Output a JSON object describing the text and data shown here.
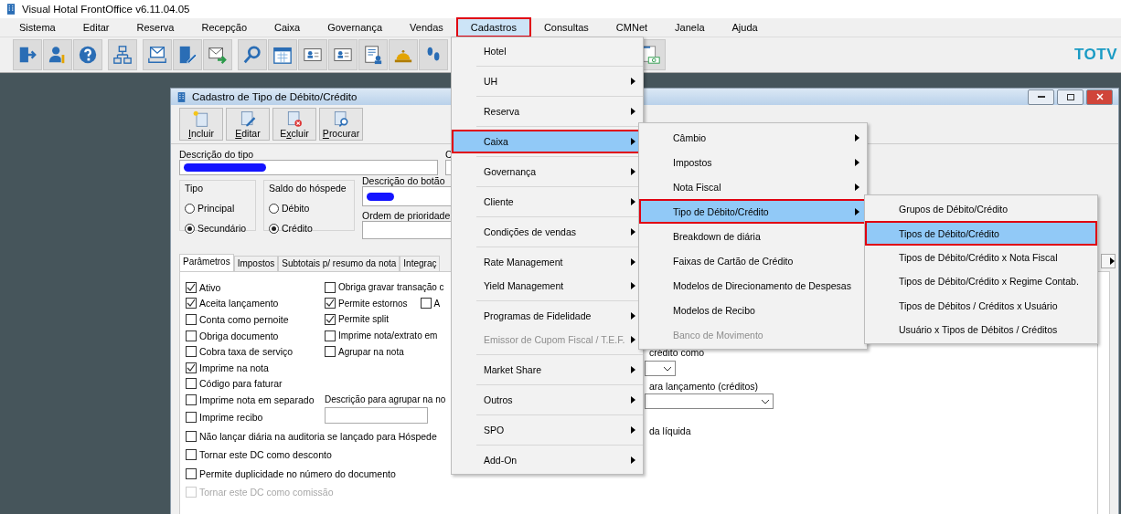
{
  "app": {
    "title": "Visual Hotal FrontOffice v6.11.04.05",
    "brand": "TOTV"
  },
  "menubar": [
    {
      "label": "Sistema",
      "selected": false,
      "highlighted": false
    },
    {
      "label": "Editar",
      "selected": false,
      "highlighted": false
    },
    {
      "label": "Reserva",
      "selected": false,
      "highlighted": false
    },
    {
      "label": "Recepção",
      "selected": false,
      "highlighted": false
    },
    {
      "label": "Caixa",
      "selected": false,
      "highlighted": false
    },
    {
      "label": "Governança",
      "selected": false,
      "highlighted": false
    },
    {
      "label": "Vendas",
      "selected": false,
      "highlighted": false
    },
    {
      "label": "Cadastros",
      "selected": true,
      "highlighted": true
    },
    {
      "label": "Consultas",
      "selected": false,
      "highlighted": false
    },
    {
      "label": "CMNet",
      "selected": false,
      "highlighted": false
    },
    {
      "label": "Janela",
      "selected": false,
      "highlighted": false
    },
    {
      "label": "Ajuda",
      "selected": false,
      "highlighted": false
    }
  ],
  "dialog": {
    "title": "Cadastro de Tipo de Débito/Crédito",
    "toolbar": [
      {
        "label": "Incluir"
      },
      {
        "label": "Editar"
      },
      {
        "label": "Excluir"
      },
      {
        "label": "Procurar"
      }
    ],
    "description": {
      "label": "Descrição do tipo",
      "redacted": true
    },
    "code": {
      "label": "C"
    },
    "tipo": {
      "title": "Tipo",
      "options": [
        {
          "label": "Principal",
          "selected": false
        },
        {
          "label": "Secundário",
          "selected": true
        }
      ]
    },
    "saldo": {
      "title": "Saldo do hóspede",
      "options": [
        {
          "label": "Débito",
          "selected": false
        },
        {
          "label": "Crédito",
          "selected": true
        }
      ]
    },
    "button_description": {
      "label": "Descrição do botão",
      "redacted": true
    },
    "priority": {
      "label": "Ordem de prioridade"
    },
    "tabs": [
      {
        "label": "Parâmetros",
        "selected": true
      },
      {
        "label": "Impostos",
        "selected": false
      },
      {
        "label": "Subtotais p/ resumo da nota",
        "selected": false
      },
      {
        "label": "Integraç",
        "selected": false
      }
    ],
    "checks_left": [
      {
        "label": "Ativo",
        "checked": true,
        "disabled": false
      },
      {
        "label": "Aceita lançamento",
        "checked": true,
        "disabled": false
      },
      {
        "label": "Conta como pernoite",
        "checked": false,
        "disabled": false
      },
      {
        "label": "Obriga documento",
        "checked": false,
        "disabled": false
      },
      {
        "label": "Cobra taxa de serviço",
        "checked": false,
        "disabled": false
      },
      {
        "label": "Imprime na nota",
        "checked": true,
        "disabled": false
      },
      {
        "label": "Código para faturar",
        "checked": false,
        "disabled": false
      },
      {
        "label": "Imprime nota em separado",
        "checked": false,
        "disabled": false
      },
      {
        "label": "Imprime recibo",
        "checked": false,
        "disabled": false
      },
      {
        "label": "Não lançar diária na auditoria se lançado para Hóspede",
        "checked": false,
        "disabled": false
      },
      {
        "label": "Tornar este DC como desconto",
        "checked": false,
        "disabled": false
      },
      {
        "label": "Permite duplicidade no número do documento",
        "checked": false,
        "disabled": false
      },
      {
        "label": "Tornar este DC como comissão",
        "checked": false,
        "disabled": true
      }
    ],
    "checks_right": [
      {
        "label": "Obriga gravar transação c",
        "checked": false
      },
      {
        "label": "Permite estornos",
        "checked": true,
        "beside": {
          "label": "A",
          "checked": false
        }
      },
      {
        "label": "Permite split",
        "checked": true
      },
      {
        "label": "Imprime nota/extrato em",
        "checked": false
      },
      {
        "label": "Agrupar na nota",
        "checked": false
      }
    ],
    "group_description": {
      "label": "Descrição para agrupar na no"
    },
    "credit_as": {
      "label": "crédito como"
    },
    "posting": {
      "label": "ara lançamento (créditos)"
    },
    "net": {
      "label": "da líquida"
    }
  },
  "menus": [
    {
      "groups": [
        [
          {
            "label": "Hotel",
            "submenu": false,
            "selected": false,
            "highlighted": false,
            "disabled": false
          }
        ],
        [
          {
            "label": "UH",
            "submenu": true,
            "selected": false,
            "highlighted": false,
            "disabled": false
          }
        ],
        [
          {
            "label": "Reserva",
            "submenu": true,
            "selected": false,
            "highlighted": false,
            "disabled": false
          }
        ],
        [
          {
            "label": "Caixa",
            "submenu": true,
            "selected": true,
            "highlighted": true,
            "disabled": false
          }
        ],
        [
          {
            "label": "Governança",
            "submenu": true,
            "selected": false,
            "highlighted": false,
            "disabled": false
          }
        ],
        [
          {
            "label": "Cliente",
            "submenu": true,
            "selected": false,
            "highlighted": false,
            "disabled": false
          }
        ],
        [
          {
            "label": "Condições de vendas",
            "submenu": true,
            "selected": false,
            "highlighted": false,
            "disabled": false
          }
        ],
        [
          {
            "label": "Rate Management",
            "submenu": true,
            "selected": false,
            "highlighted": false,
            "disabled": false
          },
          {
            "label": "Yield Management",
            "submenu": true,
            "selected": false,
            "highlighted": false,
            "disabled": false
          }
        ],
        [
          {
            "label": "Programas de Fidelidade",
            "submenu": true,
            "selected": false,
            "highlighted": false,
            "disabled": false
          },
          {
            "label": "Emissor de Cupom Fiscal / T.E.F.",
            "submenu": true,
            "selected": false,
            "highlighted": false,
            "disabled": true
          }
        ],
        [
          {
            "label": "Market Share",
            "submenu": true,
            "selected": false,
            "highlighted": false,
            "disabled": false
          }
        ],
        [
          {
            "label": "Outros",
            "submenu": true,
            "selected": false,
            "highlighted": false,
            "disabled": false
          }
        ],
        [
          {
            "label": "SPO",
            "submenu": true,
            "selected": false,
            "highlighted": false,
            "disabled": false
          }
        ],
        [
          {
            "label": "Add-On",
            "submenu": true,
            "selected": false,
            "highlighted": false,
            "disabled": false
          }
        ]
      ]
    },
    {
      "groups": [
        [
          {
            "label": "Câmbio",
            "submenu": true,
            "selected": false,
            "highlighted": false,
            "disabled": false
          },
          {
            "label": "Impostos",
            "submenu": true,
            "selected": false,
            "highlighted": false,
            "disabled": false
          },
          {
            "label": "Nota Fiscal",
            "submenu": true,
            "selected": false,
            "highlighted": false,
            "disabled": false
          },
          {
            "label": "Tipo de Débito/Crédito",
            "submenu": true,
            "selected": true,
            "highlighted": true,
            "disabled": false
          },
          {
            "label": "Breakdown de diária",
            "submenu": false,
            "selected": false,
            "highlighted": false,
            "disabled": false
          },
          {
            "label": "Faixas de Cartão de Crédito",
            "submenu": false,
            "selected": false,
            "highlighted": false,
            "disabled": false
          },
          {
            "label": "Modelos de Direcionamento de Despesas",
            "submenu": false,
            "selected": false,
            "highlighted": false,
            "disabled": false
          },
          {
            "label": "Modelos de Recibo",
            "submenu": false,
            "selected": false,
            "highlighted": false,
            "disabled": false
          },
          {
            "label": "Banco de Movimento",
            "submenu": false,
            "selected": false,
            "highlighted": false,
            "disabled": true
          }
        ]
      ]
    },
    {
      "groups": [
        [
          {
            "label": "Grupos de Débito/Crédito",
            "submenu": false,
            "selected": false,
            "highlighted": false,
            "disabled": false
          },
          {
            "label": "Tipos de Débito/Crédito",
            "submenu": false,
            "selected": true,
            "highlighted": true,
            "disabled": false
          },
          {
            "label": "Tipos de Débito/Crédito x Nota Fiscal",
            "submenu": false,
            "selected": false,
            "highlighted": false,
            "disabled": false
          },
          {
            "label": "Tipos de Débito/Crédito x Regime Contab.",
            "submenu": false,
            "selected": false,
            "highlighted": false,
            "disabled": false
          },
          {
            "label": "Tipos de Débitos / Créditos x Usuário",
            "submenu": false,
            "selected": false,
            "highlighted": false,
            "disabled": false
          },
          {
            "label": "Usuário x Tipos de Débitos / Créditos",
            "submenu": false,
            "selected": false,
            "highlighted": false,
            "disabled": false
          }
        ]
      ]
    }
  ]
}
